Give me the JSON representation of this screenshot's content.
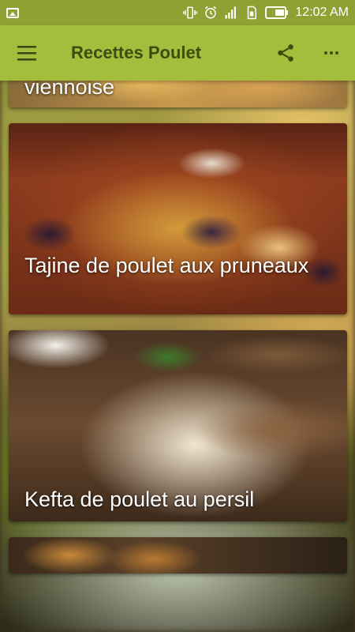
{
  "status_bar": {
    "time": "12:02 AM",
    "icons": [
      "image-icon",
      "vibrate-icon",
      "alarm-icon",
      "signal-icon",
      "sim-icon",
      "battery-icon"
    ]
  },
  "app_bar": {
    "title": "Recettes Poulet",
    "icons": [
      "menu-icon",
      "share-icon",
      "more-vert-icon"
    ],
    "background": "#a4bd3d",
    "title_color": "#3d4d12"
  },
  "recipes": [
    {
      "title": "viennoise"
    },
    {
      "title": "Tajine de poulet aux pruneaux"
    },
    {
      "title": "Kefta de poulet au persil"
    },
    {
      "title": ""
    }
  ]
}
